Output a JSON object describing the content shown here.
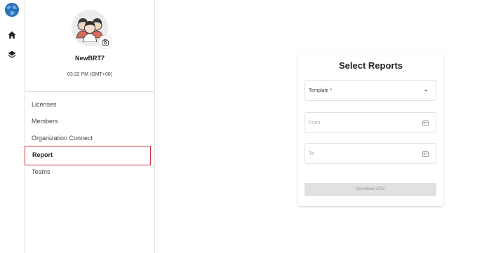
{
  "rail": {
    "icons": [
      "globe-logo-icon",
      "home-icon",
      "layers-icon"
    ]
  },
  "profile": {
    "username": "NewBRT7",
    "time": "03:32 PM (GMT+08)"
  },
  "nav": {
    "items": [
      {
        "label": "Licenses"
      },
      {
        "label": "Members"
      },
      {
        "label": "Organization Connect"
      },
      {
        "label": "Report",
        "active": true
      },
      {
        "label": "Teams"
      }
    ]
  },
  "report": {
    "title": "Select Reports",
    "template_label": "Template *",
    "from_label": "From",
    "to_label": "To",
    "download_label": "Download CSV"
  },
  "colors": {
    "active_border": "#d9363e",
    "brand_blue": "#2b6fb5"
  }
}
